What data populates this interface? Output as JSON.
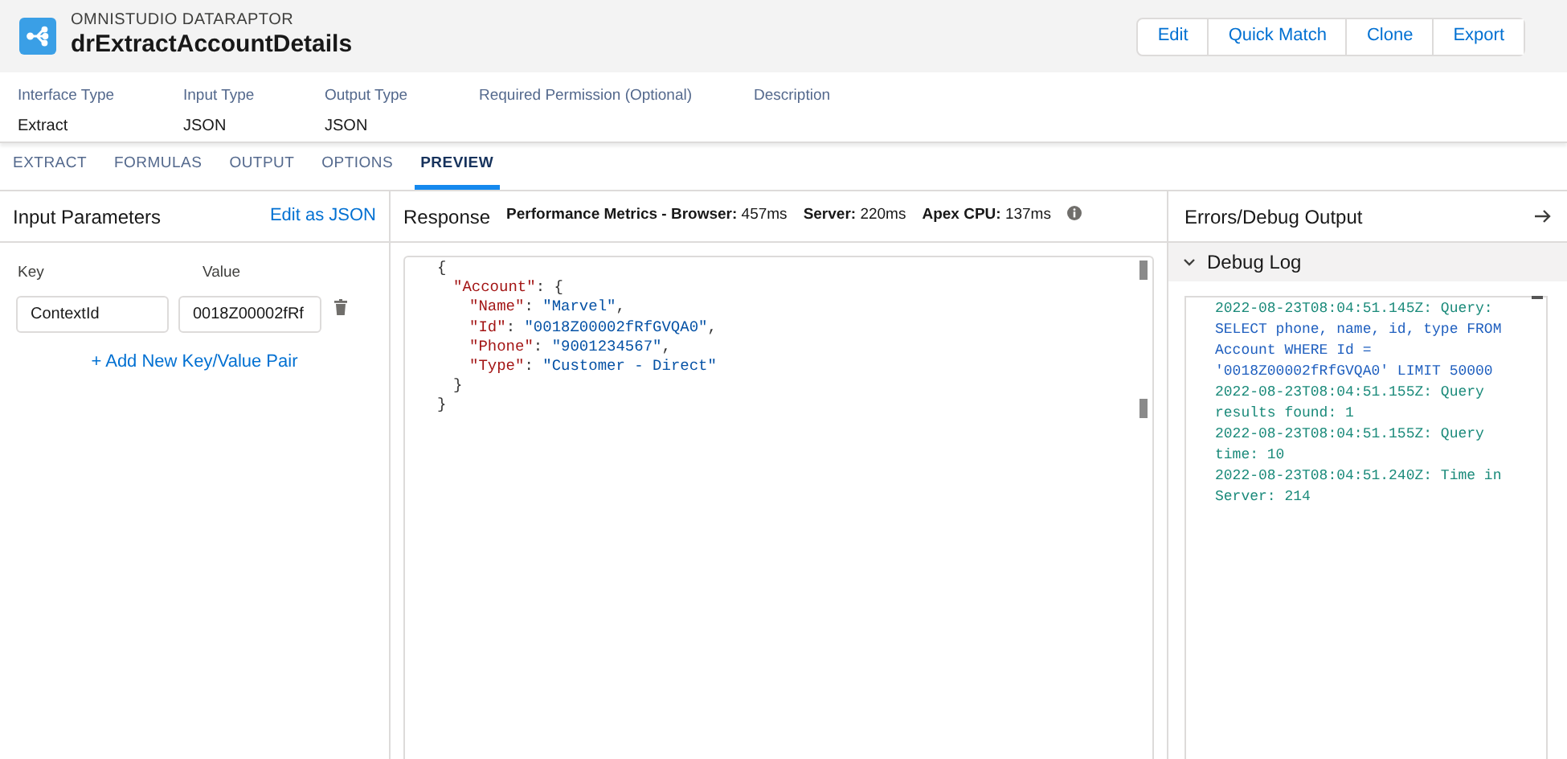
{
  "header": {
    "eyebrow": "OMNISTUDIO DATARAPTOR",
    "title": "drExtractAccountDetails",
    "buttons": [
      "Edit",
      "Quick Match",
      "Clone",
      "Export"
    ]
  },
  "details": [
    {
      "label": "Interface Type",
      "value": "Extract"
    },
    {
      "label": "Input Type",
      "value": "JSON"
    },
    {
      "label": "Output Type",
      "value": "JSON"
    },
    {
      "label": "Required Permission (Optional)"
    },
    {
      "label": "Description"
    }
  ],
  "tabs": [
    {
      "label": "EXTRACT",
      "selected": false
    },
    {
      "label": "FORMULAS",
      "selected": false
    },
    {
      "label": "OUTPUT",
      "selected": false
    },
    {
      "label": "OPTIONS",
      "selected": false
    },
    {
      "label": "PREVIEW",
      "selected": true
    }
  ],
  "input_parameters": {
    "title": "Input Parameters",
    "link": "Edit as JSON",
    "key_label": "Key",
    "value_label": "Value",
    "rows": [
      {
        "key": "ContextId",
        "value": "0018Z00002fRf"
      }
    ],
    "add_link": "+ Add New Key/Value Pair"
  },
  "response": {
    "title": "Response",
    "metrics": [
      {
        "label": "Performance Metrics - Browser:",
        "value": "457ms"
      },
      {
        "label": "Server:",
        "value": "220ms"
      },
      {
        "label": "Apex CPU:",
        "value": "137ms"
      }
    ],
    "lines": [
      {
        "tokens": [
          {
            "kind": "punct",
            "text": "{"
          }
        ],
        "children": [
          {
            "tokens": [
              {
                "kind": "key",
                "text": "\"Account\""
              },
              {
                "kind": "punct",
                "text": ": {"
              }
            ],
            "children": [
              {
                "tokens": [
                  {
                    "kind": "key",
                    "text": "\"Name\""
                  },
                  {
                    "kind": "punct",
                    "text": ": "
                  },
                  {
                    "kind": "string",
                    "text": "\"Marvel\""
                  },
                  {
                    "kind": "punct",
                    "text": ","
                  }
                ]
              },
              {
                "tokens": [
                  {
                    "kind": "key",
                    "text": "\"Id\""
                  },
                  {
                    "kind": "punct",
                    "text": ": "
                  },
                  {
                    "kind": "string",
                    "text": "\"0018Z00002fRfGVQA0\""
                  },
                  {
                    "kind": "punct",
                    "text": ","
                  }
                ]
              },
              {
                "tokens": [
                  {
                    "kind": "key",
                    "text": "\"Phone\""
                  },
                  {
                    "kind": "punct",
                    "text": ": "
                  },
                  {
                    "kind": "string",
                    "text": "\"9001234567\""
                  },
                  {
                    "kind": "punct",
                    "text": ","
                  }
                ]
              },
              {
                "tokens": [
                  {
                    "kind": "key",
                    "text": "\"Type\""
                  },
                  {
                    "kind": "punct",
                    "text": ": "
                  },
                  {
                    "kind": "string",
                    "text": "\"Customer - Direct\""
                  }
                ]
              }
            ]
          },
          {
            "tokens": [
              {
                "kind": "punct",
                "text": "}"
              }
            ]
          }
        ]
      },
      {
        "tokens": [
          {
            "kind": "punct",
            "text": "}"
          }
        ]
      }
    ]
  },
  "debug": {
    "title": "Errors/Debug Output",
    "section": "Debug Log",
    "expanded": true,
    "entries": [
      {
        "text": "2022-08-23T08:04:51.145Z: Query:",
        "query": "SELECT phone, name, id, type FROM Account WHERE Id = '0018Z00002fRfGVQA0' LIMIT 50000"
      },
      {
        "text": "2022-08-23T08:04:51.155Z: Query results found: 1"
      },
      {
        "text": "2022-08-23T08:04:51.155Z: Query time: 10"
      },
      {
        "text": "2022-08-23T08:04:51.240Z: Time in Server: 214"
      }
    ]
  }
}
